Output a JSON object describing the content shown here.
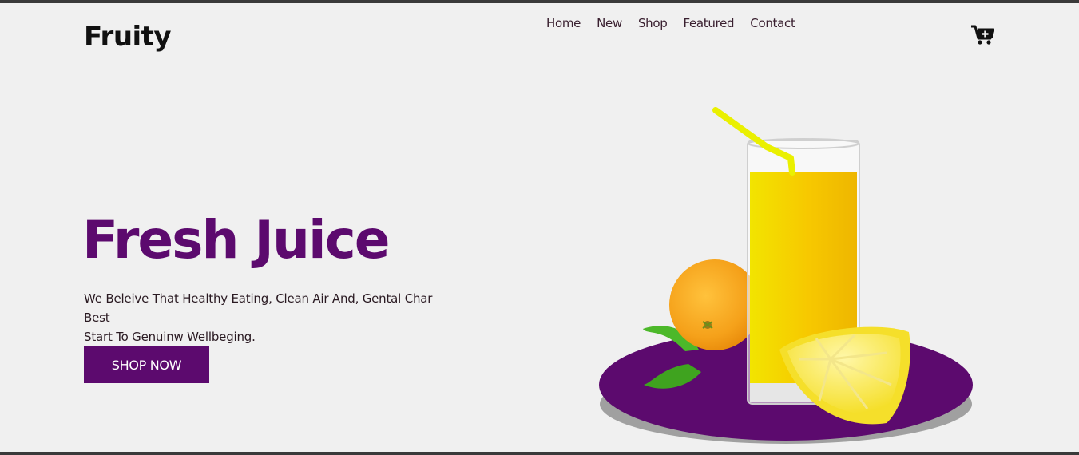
{
  "brand": {
    "logo_text": "Fruity"
  },
  "nav": {
    "items": [
      {
        "label": "Home"
      },
      {
        "label": "New"
      },
      {
        "label": "Shop"
      },
      {
        "label": "Featured"
      },
      {
        "label": "Contact"
      }
    ]
  },
  "header": {
    "cart_icon": "cart-plus-icon"
  },
  "hero": {
    "title": "Fresh Juice",
    "line1": "We Beleive That Healthy Eating, Clean Air And, Gental Char Best",
    "line2": "Start To Genuinw Wellbeging.",
    "cta_label": "SHOP NOW"
  },
  "colors": {
    "brand_purple": "#5c0a6e",
    "background": "#f0f0f0",
    "juice_yellow": "#f5d000",
    "orange": "#f5a11a"
  }
}
